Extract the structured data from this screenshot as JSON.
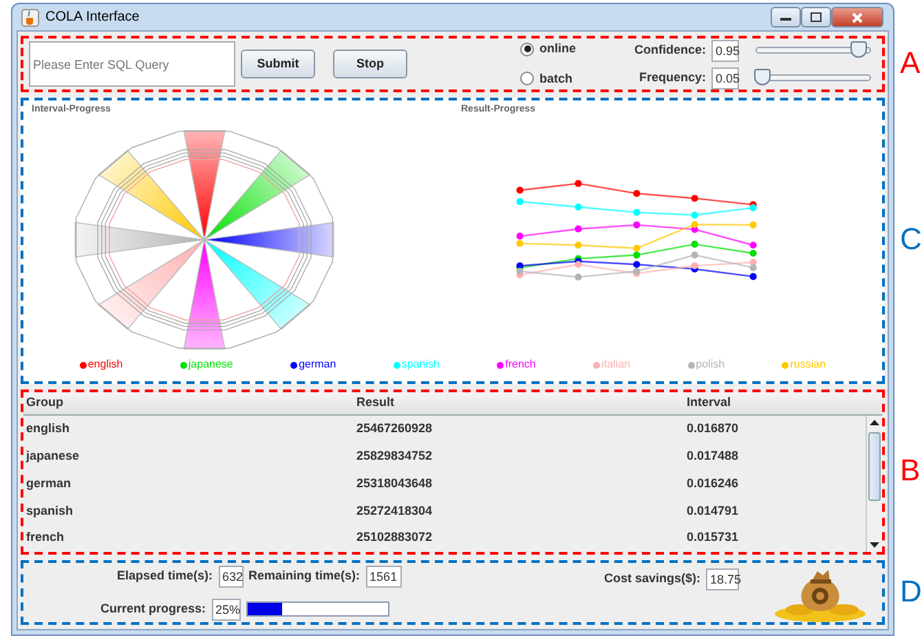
{
  "window": {
    "title": "COLA Interface"
  },
  "query_panel": {
    "annotation": {
      "label": "A",
      "color": "#ff0000"
    },
    "query": {
      "placeholder": "Please Enter SQL Query"
    },
    "buttons": [
      "Submit",
      "Stop"
    ],
    "modes": [
      {
        "label": "online",
        "selected": true
      },
      {
        "label": "batch",
        "selected": false
      }
    ],
    "sliders": [
      {
        "label": "Confidence:",
        "value": "0.95",
        "level": 0.9
      },
      {
        "label": "Frequency:",
        "value": "0.05",
        "level": 0.05
      }
    ]
  },
  "progress_panel": {
    "annotation": {
      "label": "C",
      "color": "#0070c0"
    },
    "charts": [
      {
        "title": "Interval-Progress",
        "kind": "radial"
      },
      {
        "title": "Result-Progress",
        "kind": "line"
      }
    ],
    "legend": [
      {
        "label": "english",
        "color": "#ff0000"
      },
      {
        "label": "japanese",
        "color": "#00e000"
      },
      {
        "label": "german",
        "color": "#0000ff"
      },
      {
        "label": "spanish",
        "color": "#00ffff"
      },
      {
        "label": "french",
        "color": "#ff00ff"
      },
      {
        "label": "italian",
        "color": "#ffafaf"
      },
      {
        "label": "polish",
        "color": "#b4b4b4"
      },
      {
        "label": "russian",
        "color": "#ffc800"
      }
    ]
  },
  "table": {
    "annotation": {
      "label": "B",
      "color": "#ff0000"
    },
    "columns": [
      "Group",
      "Result",
      "Interval"
    ],
    "rows": [
      [
        "english",
        "25467260928",
        "0.016870"
      ],
      [
        "japanese",
        "25829834752",
        "0.017488"
      ],
      [
        "german",
        "25318043648",
        "0.016246"
      ],
      [
        "spanish",
        "25272418304",
        "0.014791"
      ],
      [
        "french",
        "25102883072",
        "0.015731"
      ]
    ]
  },
  "stats_panel": {
    "annotation": {
      "label": "D",
      "color": "#0070c0"
    },
    "elapsed": {
      "label": "Elapsed time(s):",
      "value": "632"
    },
    "remaining": {
      "label": "Remaining time(s):",
      "value": "1561"
    },
    "savings": {
      "label": "Cost savings($):",
      "value": "18.75"
    },
    "progress": {
      "label": "Current progress:",
      "value": "25%",
      "level": 0.25
    }
  }
}
